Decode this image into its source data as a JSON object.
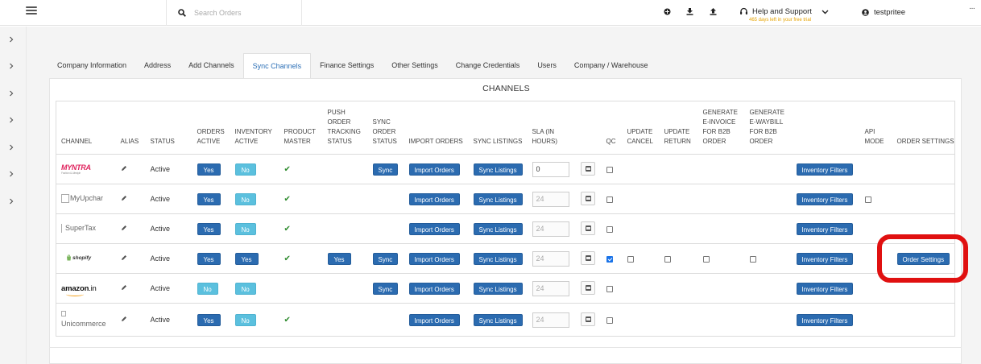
{
  "topbar": {
    "search_placeholder": "Search Orders",
    "help_label": "Help and Support",
    "trial_note": "465 days left in your free trial",
    "username": "testpritee",
    "more_label": "···",
    "trial_color": "#e6a300"
  },
  "tabs": [
    {
      "label": "Company Information",
      "active": false
    },
    {
      "label": "Address",
      "active": false
    },
    {
      "label": "Add Channels",
      "active": false
    },
    {
      "label": "Sync Channels",
      "active": true
    },
    {
      "label": "Finance Settings",
      "active": false
    },
    {
      "label": "Other Settings",
      "active": false
    },
    {
      "label": "Change Credentials",
      "active": false
    },
    {
      "label": "Users",
      "active": false
    },
    {
      "label": "Company / Warehouse",
      "active": false
    }
  ],
  "panel": {
    "title": "CHANNELS"
  },
  "table": {
    "headers": {
      "channel": "CHANNEL",
      "alias": "ALIAS",
      "status": "STATUS",
      "orders_active": "ORDERS ACTIVE",
      "inventory_active": "INVENTORY ACTIVE",
      "product_master": "PRODUCT MASTER",
      "push_order_tracking": "PUSH ORDER TRACKING STATUS",
      "sync_order_status": "SYNC ORDER STATUS",
      "import_orders": "IMPORT ORDERS",
      "sync_listings": "SYNC LISTINGS",
      "sla": "SLA (IN HOURS)",
      "qc": "QC",
      "update_cancel": "UPDATE CANCEL",
      "update_return": "UPDATE RETURN",
      "generate_einvoice": "GENERATE E-INVOICE FOR B2B ORDER",
      "generate_ewaybill": "GENERATE E-WAYBILL FOR B2B ORDER",
      "api_mode": "API MODE",
      "order_settings": "ORDER SETTINGS"
    },
    "buttons": {
      "import_orders": "Import Orders",
      "sync_listings": "Sync Listings",
      "inventory_filters": "Inventory Filters",
      "sync": "Sync",
      "order_settings": "Order Settings"
    },
    "rows": [
      {
        "logo_text": "MYNTRA",
        "logo_sub": "Fashion & Lifestyle",
        "status": "Active",
        "orders_active": "Yes",
        "inventory_active": "No",
        "sla": "0"
      },
      {
        "logo_text": "MyUpchar",
        "status": "Active",
        "orders_active": "Yes",
        "inventory_active": "No",
        "sla": "24"
      },
      {
        "logo_text": "SuperTax",
        "status": "Active",
        "orders_active": "Yes",
        "inventory_active": "No",
        "sla": "24"
      },
      {
        "logo_text": "shopify",
        "status": "Active",
        "orders_active": "Yes",
        "inventory_active": "Yes",
        "push_order_tracking": "Yes",
        "sla": "24"
      },
      {
        "logo_text": "amazon",
        "logo_suffix": ".in",
        "status": "Active",
        "orders_active": "No",
        "inventory_active": "No",
        "sla": "24"
      },
      {
        "logo_text": "Unicommerce",
        "status": "Active",
        "orders_active": "Yes",
        "inventory_active": "No",
        "sla": "24"
      }
    ]
  },
  "colors": {
    "primary_button": "#2b6bb0",
    "light_button": "#5bc0de",
    "active_status": "#3e8f3e",
    "active_tab": "#2c6fb6",
    "callout": "#e01010"
  }
}
